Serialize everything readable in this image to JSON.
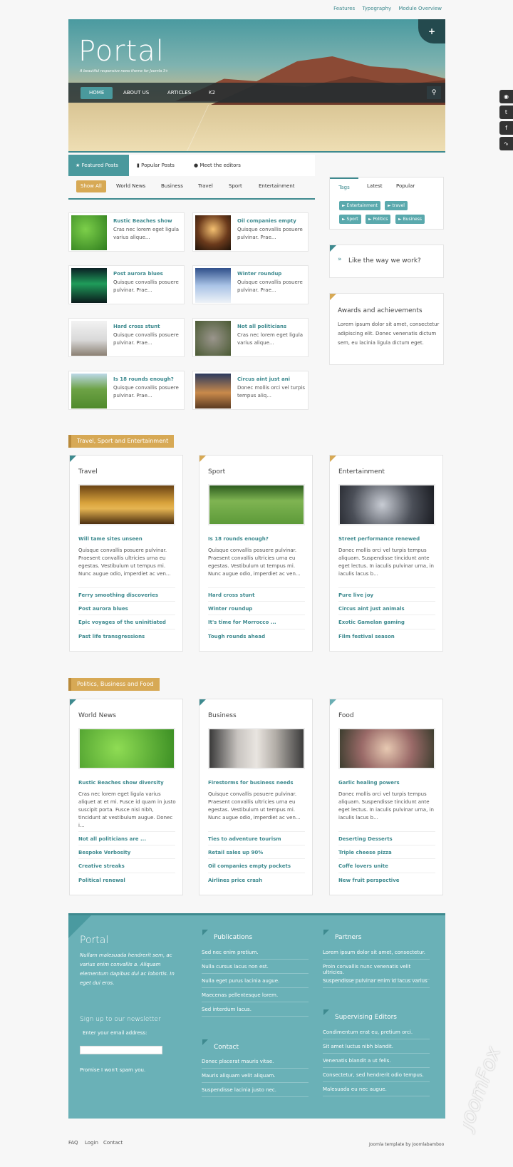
{
  "toplinks": [
    "Features",
    "Typography",
    "Module Overview"
  ],
  "hero": {
    "title": "Portal",
    "subtitle": "A beautiful responsive news theme for Joomla 3+"
  },
  "nav": {
    "items": [
      "HOME",
      "ABOUT US",
      "ARTICLES",
      "K2"
    ]
  },
  "tabs": [
    "Featured Posts",
    "Popular Posts",
    "Meet the editors"
  ],
  "filters": [
    "Show All",
    "World News",
    "Business",
    "Travel",
    "Sport",
    "Entertainment"
  ],
  "cards": [
    {
      "title": "Rustic Beaches show",
      "desc": "Cras nec lorem eget ligula varius alique..."
    },
    {
      "title": "Oil companies empty",
      "desc": "Quisque convallis posuere pulvinar. Prae..."
    },
    {
      "title": "Post aurora blues",
      "desc": "Quisque convallis posuere pulvinar. Prae..."
    },
    {
      "title": "Winter roundup",
      "desc": "Quisque convallis posuere pulvinar. Prae..."
    },
    {
      "title": "Hard cross stunt",
      "desc": "Quisque convallis posuere pulvinar. Prae..."
    },
    {
      "title": "Not all politicians",
      "desc": "Cras nec lorem eget ligula varius alique..."
    },
    {
      "title": "Is 18 rounds enough?",
      "desc": "Quisque convallis posuere pulvinar. Prae..."
    },
    {
      "title": "Circus aint just ani",
      "desc": "Donec mollis orci vel turpis tempus aliq..."
    }
  ],
  "sidebar": {
    "tabs": [
      "Tags",
      "Latest",
      "Popular"
    ],
    "tags": [
      "Entertainment",
      "travel",
      "Sport",
      "Politics",
      "Business"
    ],
    "like": "Like the way we work?",
    "awards_title": "Awards and achievements",
    "awards_text": "Lorem ipsum dolor sit amet, consectetur adipiscing elit. Donec venenatis dictum sem, eu lacinia ligula dictum eget."
  },
  "sections": [
    {
      "title": "Travel, Sport and Entertainment",
      "cols": [
        {
          "title": "Travel",
          "headline": "Will tame sites unseen",
          "desc": "Quisque convallis posuere pulvinar. Praesent convallis ultricies urna eu egestas. Vestibulum ut tempus mi. Nunc augue odio, imperdiet ac ven...",
          "links": [
            "Ferry smoothing discoveries",
            "Post aurora blues",
            "Epic voyages of the uninitiated",
            "Past life transgressions"
          ]
        },
        {
          "title": "Sport",
          "headline": "Is 18 rounds enough?",
          "desc": "Quisque convallis posuere pulvinar. Praesent convallis ultricies urna eu egestas. Vestibulum ut tempus mi. Nunc augue odio, imperdiet ac ven...",
          "links": [
            "Hard cross stunt",
            "Winter roundup",
            "It's time for Morrocco ...",
            "Tough rounds ahead"
          ]
        },
        {
          "title": "Entertainment",
          "headline": "Street performance renewed",
          "desc": "Donec mollis orci vel turpis tempus aliquam. Suspendisse tincidunt ante eget lectus. In iaculis pulvinar urna, in iaculis lacus b...",
          "links": [
            "Pure live joy",
            "Circus aint just animals",
            "Exotic Gamelan gaming",
            "Film festival season"
          ]
        }
      ]
    },
    {
      "title": "Politics, Business and Food",
      "cols": [
        {
          "title": "World News",
          "headline": "Rustic Beaches show diversity",
          "desc": "Cras nec lorem eget ligula varius aliquet at et mi. Fusce id quam in justo suscipit porta. Fusce nisi nibh, tincidunt at vestibulum augue. Donec i...",
          "links": [
            "Not all politicians are ...",
            "Bespoke Verbosity",
            "Creative streaks",
            "Political renewal"
          ]
        },
        {
          "title": "Business",
          "headline": "Firestorms for business needs",
          "desc": " Quisque convallis posuere pulvinar. Praesent convallis ultricies urna eu egestas. Vestibulum ut tempus mi. Nunc augue odio, imperdiet ac ven...",
          "links": [
            "Ties to adventure tourism",
            "Retail sales up 90%",
            "Oil companies empty pockets",
            "Airlines price crash"
          ]
        },
        {
          "title": "Food",
          "headline": "Garlic healing powers",
          "desc": "Donec mollis orci vel turpis tempus aliquam. Suspendisse tincidunt ante eget lectus. In iaculis pulvinar urna, in iaculis lacus b...",
          "links": [
            "Deserting Desserts",
            "Triple cheese pizza",
            "Coffe lovers unite",
            "New fruit perspective"
          ]
        }
      ]
    }
  ],
  "footer": {
    "title": "Portal",
    "intro": "Nullam malesuada hendrerit sem, ac varius enim convallis a. Aliquam elementum dapibus dui ac lobortis. In eget dui eros.",
    "newsletter": "Sign up to our newsletter",
    "email_label": "Enter your email address:",
    "promise": "Promise I won't spam you.",
    "publications": {
      "title": "Publications",
      "links": [
        "Sed nec enim pretium.",
        "Nulla cursus lacus non est.",
        "Nulla eget purus lacinia augue.",
        "Maecenas pellentesque lorem.",
        "Sed interdum lacus."
      ]
    },
    "contact": {
      "title": "Contact",
      "links": [
        "Donec placerat mauris vitae.",
        "Mauris aliquam velit aliquam.",
        "Suspendisse lacinia justo nec."
      ]
    },
    "partners": {
      "title": "Partners",
      "links": [
        "Lorem ipsum dolor sit amet, consectetur.",
        "Proin convallis nunc venenatis velit ultricies.",
        "Suspendisse pulvinar enim id lacus varius"
      ]
    },
    "editors": {
      "title": "Supervising Editors",
      "links": [
        "Condimentum erat eu, pretium orci.",
        "Sit amet luctus nibh blandit.",
        "Venenatis blandit a ut felis.",
        "Consectetur, sed hendrerit odio tempus.",
        "Malesuada eu nec augue."
      ]
    }
  },
  "bottom": {
    "links": [
      "FAQ",
      "Login",
      "Contact"
    ],
    "credit": "Joomla template by Joomlabamboo"
  },
  "watermark": "JoomFox"
}
